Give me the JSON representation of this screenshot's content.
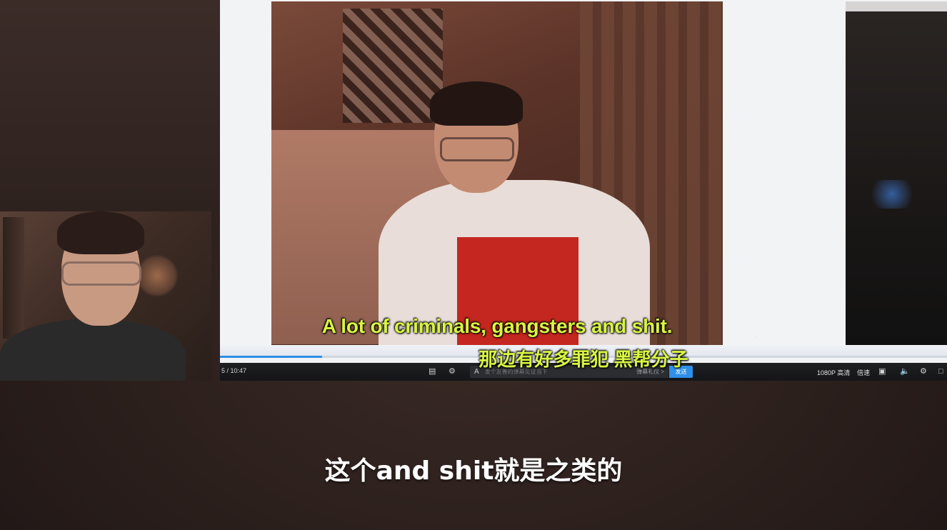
{
  "player": {
    "time": "5 / 10:47",
    "progress": 0.14,
    "danmaku": {
      "placeholder": "发个友善的弹幕见证当下",
      "etiquette_label": "弹幕礼仪 >",
      "send_label": "发送"
    },
    "quality_label": "1080P 高清",
    "speed_label": "倍速",
    "icons": [
      "danmaku-toggle-icon",
      "danmaku-settings-icon",
      "danmaku-a-icon",
      "danmaku-off-icon",
      "volume-icon",
      "settings-icon",
      "fullscreen-icon"
    ]
  },
  "subtitles": {
    "video_en": "A lot of criminals, gangsters and shit.",
    "video_zh": "那边有好多罪犯 黑帮分子",
    "main_zh": "这个and shit就是之类的"
  },
  "colors": {
    "subtitle_yellow": "#d8f542",
    "progress_blue": "#2e8fe8",
    "send_button": "#2e8fe8"
  }
}
